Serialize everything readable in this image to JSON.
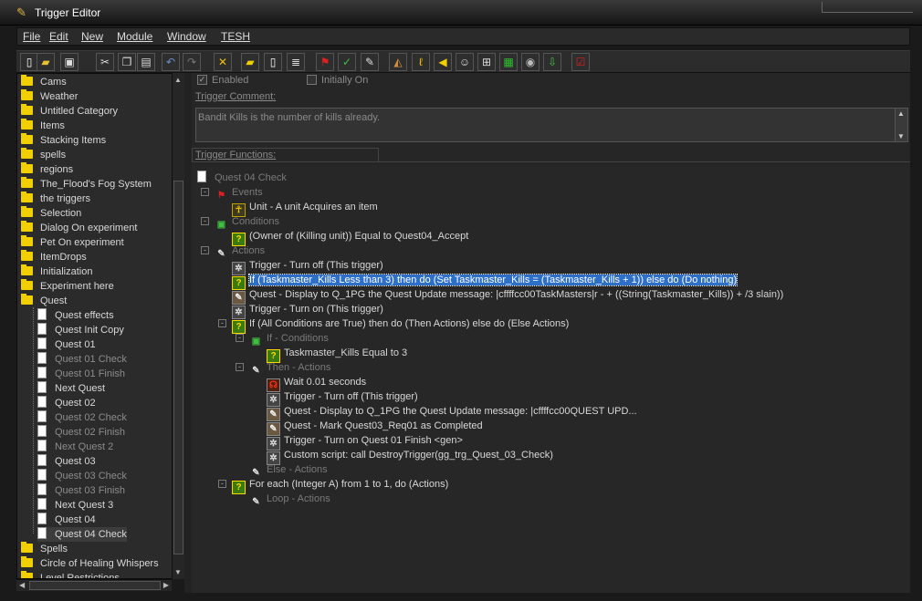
{
  "window": {
    "title": "Trigger Editor"
  },
  "menu": [
    "File",
    "Edit",
    "New",
    "Module",
    "Window",
    "TESH"
  ],
  "toolbar": [
    {
      "icon": "new-icon",
      "glyph": "▯",
      "color": "#ffffff"
    },
    {
      "icon": "open-icon",
      "glyph": "▰",
      "color": "#e8c030"
    },
    {
      "icon": "save-icon",
      "glyph": "▣",
      "color": "#dddddd"
    },
    {
      "icon": "cut-icon",
      "glyph": "✂",
      "color": "#dddddd"
    },
    {
      "icon": "copy-icon",
      "glyph": "❐",
      "color": "#dddddd"
    },
    {
      "icon": "paste-icon",
      "glyph": "▤",
      "color": "#dddddd"
    },
    {
      "icon": "undo-icon",
      "glyph": "↶",
      "color": "#6a8cc8"
    },
    {
      "icon": "redo-icon",
      "glyph": "↷",
      "color": "#777777"
    },
    {
      "icon": "delete-icon",
      "glyph": "✕",
      "color": "#f0c000"
    },
    {
      "icon": "new-category-icon",
      "glyph": "▰",
      "color": "#f0d000"
    },
    {
      "icon": "new-trigger-icon",
      "glyph": "▯",
      "color": "#ffffff"
    },
    {
      "icon": "new-comment-icon",
      "glyph": "≣",
      "color": "#dddddd"
    },
    {
      "icon": "new-event-icon",
      "glyph": "⚑",
      "color": "#e02020"
    },
    {
      "icon": "new-condition-icon",
      "glyph": "✓",
      "color": "#40c040"
    },
    {
      "icon": "new-action-icon",
      "glyph": "✎",
      "color": "#dddddd"
    },
    {
      "icon": "terrain-editor-icon",
      "glyph": "◭",
      "color": "#d09040"
    },
    {
      "icon": "trigger-editor-icon",
      "glyph": "ℓ",
      "color": "#f0c000"
    },
    {
      "icon": "sound-editor-icon",
      "glyph": "◀",
      "color": "#f0d000"
    },
    {
      "icon": "object-editor-icon",
      "glyph": "☺",
      "color": "#dddddd"
    },
    {
      "icon": "campaign-editor-icon",
      "glyph": "⊞",
      "color": "#dddddd"
    },
    {
      "icon": "ai-editor-icon",
      "glyph": "▦",
      "color": "#30c030"
    },
    {
      "icon": "object-manager-icon",
      "glyph": "◉",
      "color": "#bbbbbb"
    },
    {
      "icon": "import-manager-icon",
      "glyph": "⇩",
      "color": "#40c040"
    },
    {
      "icon": "test-map-icon",
      "glyph": "☑",
      "color": "#e02020"
    }
  ],
  "left_tree": [
    {
      "label": "Cams",
      "type": "folder",
      "indent": 0
    },
    {
      "label": "Weather",
      "type": "folder",
      "indent": 0
    },
    {
      "label": "Untitled Category",
      "type": "folder",
      "indent": 0
    },
    {
      "label": "Items",
      "type": "folder",
      "indent": 0
    },
    {
      "label": "Stacking Items",
      "type": "folder",
      "indent": 0
    },
    {
      "label": "spells",
      "type": "folder",
      "indent": 0
    },
    {
      "label": "regions",
      "type": "folder",
      "indent": 0
    },
    {
      "label": "The_Flood's Fog System",
      "type": "folder",
      "indent": 0
    },
    {
      "label": "the triggers",
      "type": "folder",
      "indent": 0
    },
    {
      "label": "Selection",
      "type": "folder",
      "indent": 0
    },
    {
      "label": "Dialog On experiment",
      "type": "folder",
      "indent": 0
    },
    {
      "label": "Pet On experiment",
      "type": "folder",
      "indent": 0
    },
    {
      "label": "ItemDrops",
      "type": "folder",
      "indent": 0
    },
    {
      "label": "Initialization",
      "type": "folder",
      "indent": 0
    },
    {
      "label": "Experiment here",
      "type": "folder",
      "indent": 0
    },
    {
      "label": "Quest",
      "type": "folder-open",
      "indent": 0
    },
    {
      "label": "Quest effects",
      "type": "doc",
      "indent": 1
    },
    {
      "label": "Quest Init Copy",
      "type": "doc",
      "indent": 1
    },
    {
      "label": "Quest 01",
      "type": "doc",
      "indent": 1
    },
    {
      "label": "Quest 01 Check",
      "type": "doc",
      "indent": 1,
      "muted": true
    },
    {
      "label": "Quest 01 Finish",
      "type": "doc",
      "indent": 1,
      "muted": true
    },
    {
      "label": "Next Quest",
      "type": "doc",
      "indent": 1
    },
    {
      "label": "Quest 02",
      "type": "doc",
      "indent": 1
    },
    {
      "label": "Quest 02 Check",
      "type": "doc",
      "indent": 1,
      "muted": true
    },
    {
      "label": "Quest 02 Finish",
      "type": "doc",
      "indent": 1,
      "muted": true
    },
    {
      "label": "Next Quest 2",
      "type": "doc",
      "indent": 1,
      "muted": true
    },
    {
      "label": "Quest 03",
      "type": "doc",
      "indent": 1
    },
    {
      "label": "Quest 03 Check",
      "type": "doc",
      "indent": 1,
      "muted": true
    },
    {
      "label": "Quest 03 Finish",
      "type": "doc",
      "indent": 1,
      "muted": true
    },
    {
      "label": "Next Quest 3",
      "type": "doc",
      "indent": 1
    },
    {
      "label": "Quest 04",
      "type": "doc",
      "indent": 1
    },
    {
      "label": "Quest 04 Check",
      "type": "doc",
      "indent": 1,
      "selected": true
    },
    {
      "label": "Spells",
      "type": "folder",
      "indent": 0
    },
    {
      "label": "Circle of Healing Whispers",
      "type": "folder",
      "indent": 0
    },
    {
      "label": "Level Restrictions",
      "type": "folder",
      "indent": 0
    }
  ],
  "props": {
    "enabled_label": "Enabled",
    "enabled_checked": true,
    "initially_on_label": "Initially On",
    "initially_on_checked": false,
    "comment_label": "Trigger Comment:",
    "comment_text": "Bandit Kills is the number of kills already.",
    "functions_label": "Trigger Functions:"
  },
  "functions": [
    {
      "text": "Quest 04 Check",
      "icon": "doc",
      "glyph": "",
      "indent": 0,
      "muted": true
    },
    {
      "text": "Events",
      "icon": "cat",
      "glyph": "⚑",
      "indent": 1,
      "muted": true,
      "expander": "-"
    },
    {
      "text": "Unit - A unit Acquires an item",
      "icon": "unit",
      "glyph": "☥",
      "indent": 2
    },
    {
      "text": "Conditions",
      "icon": "cat",
      "glyph": "▣",
      "indent": 1,
      "muted": true,
      "expander": "-"
    },
    {
      "text": "(Owner of (Killing unit)) Equal to Quest04_Accept",
      "icon": "q",
      "glyph": "?",
      "indent": 2
    },
    {
      "text": "Actions",
      "icon": "cat",
      "glyph": "✎",
      "indent": 1,
      "muted": true,
      "expander": "-"
    },
    {
      "text": "Trigger - Turn off (This trigger)",
      "icon": "gear",
      "glyph": "✲",
      "indent": 2
    },
    {
      "text": "If (Taskmaster_Kills Less than 3) then do (Set Taskmaster_Kills = (Taskmaster_Kills + 1)) else do (Do nothing)",
      "icon": "q",
      "glyph": "?",
      "indent": 2,
      "selected": true
    },
    {
      "text": "Quest - Display to Q_1PG the Quest Update message: |cffffcc00TaskMasters|r -  + ((String(Taskmaster_Kills)) + /3 slain))",
      "icon": "quest",
      "glyph": "✎",
      "indent": 2
    },
    {
      "text": "Trigger - Turn on (This trigger)",
      "icon": "gear",
      "glyph": "✲",
      "indent": 2
    },
    {
      "text": "If (All Conditions are True) then do (Then Actions) else do (Else Actions)",
      "icon": "q",
      "glyph": "?",
      "indent": 2,
      "expander": "-"
    },
    {
      "text": "If - Conditions",
      "icon": "cat",
      "glyph": "▣",
      "indent": 3,
      "muted": true,
      "expander": "-"
    },
    {
      "text": "Taskmaster_Kills Equal to 3",
      "icon": "q",
      "glyph": "?",
      "indent": 4
    },
    {
      "text": "Then - Actions",
      "icon": "cat",
      "glyph": "✎",
      "indent": 3,
      "muted": true,
      "expander": "-"
    },
    {
      "text": "Wait 0.01 seconds",
      "icon": "wait",
      "glyph": "☊",
      "indent": 4
    },
    {
      "text": "Trigger - Turn off (This trigger)",
      "icon": "gear",
      "glyph": "✲",
      "indent": 4
    },
    {
      "text": "Quest - Display to Q_1PG the Quest Update message: |cffffcc00QUEST UPD...",
      "icon": "quest",
      "glyph": "✎",
      "indent": 4
    },
    {
      "text": "Quest - Mark Quest03_Req01 as Completed",
      "icon": "quest",
      "glyph": "✎",
      "indent": 4
    },
    {
      "text": "Trigger - Turn on Quest 01 Finish <gen>",
      "icon": "gear",
      "glyph": "✲",
      "indent": 4
    },
    {
      "text": "Custom script:   call DestroyTrigger(gg_trg_Quest_03_Check)",
      "icon": "gear",
      "glyph": "✲",
      "indent": 4
    },
    {
      "text": "Else - Actions",
      "icon": "cat",
      "glyph": "✎",
      "indent": 3,
      "muted": true
    },
    {
      "text": "For each (Integer A) from 1 to 1, do (Actions)",
      "icon": "q",
      "glyph": "?",
      "indent": 2,
      "expander": "-"
    },
    {
      "text": "Loop - Actions",
      "icon": "cat",
      "glyph": "✎",
      "indent": 3,
      "muted": true
    }
  ]
}
